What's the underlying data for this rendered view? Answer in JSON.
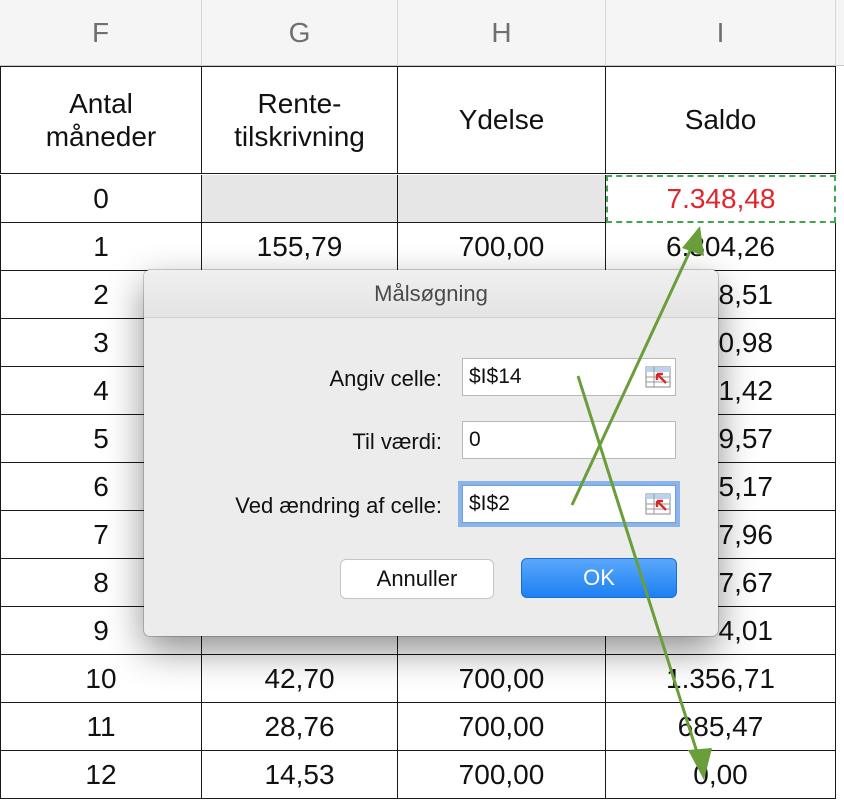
{
  "sheet": {
    "column_headers": [
      "F",
      "G",
      "H",
      "I"
    ],
    "table_headers": {
      "antal_line1": "Antal",
      "antal_line2": "måneder",
      "rente_line1": "Rente-",
      "rente_line2": "tilskrivning",
      "ydelse": "Ydelse",
      "saldo": "Saldo"
    },
    "rows": [
      {
        "months": "0",
        "interest": "",
        "payment": "",
        "balance": "7.348,48"
      },
      {
        "months": "1",
        "interest": "155,79",
        "payment": "700,00",
        "balance": "6.804,26"
      },
      {
        "months": "2",
        "interest": "",
        "payment": "",
        "balance": "8,51"
      },
      {
        "months": "3",
        "interest": "",
        "payment": "",
        "balance": "0,98"
      },
      {
        "months": "4",
        "interest": "",
        "payment": "",
        "balance": "1,42"
      },
      {
        "months": "5",
        "interest": "",
        "payment": "",
        "balance": "9,57"
      },
      {
        "months": "6",
        "interest": "",
        "payment": "",
        "balance": "5,17"
      },
      {
        "months": "7",
        "interest": "",
        "payment": "",
        "balance": "7,96"
      },
      {
        "months": "8",
        "interest": "",
        "payment": "",
        "balance": "7,67"
      },
      {
        "months": "9",
        "interest": "",
        "payment": "",
        "balance": "4,01"
      },
      {
        "months": "10",
        "interest": "42,70",
        "payment": "700,00",
        "balance": "1.356,71"
      },
      {
        "months": "11",
        "interest": "28,76",
        "payment": "700,00",
        "balance": "685,47"
      },
      {
        "months": "12",
        "interest": "14,53",
        "payment": "700,00",
        "balance": "0,00"
      }
    ],
    "highlight_color": "#e0262c",
    "selection_color": "#3fa64b"
  },
  "dialog": {
    "title": "Målsøgning",
    "set_cell_label": "Angiv celle:",
    "set_cell_value": "$I$14",
    "to_value_label": "Til værdi:",
    "to_value_value": "0",
    "changing_cell_label": "Ved ændring af celle:",
    "changing_cell_value": "$I$2",
    "cancel_label": "Annuller",
    "ok_label": "OK",
    "ok_color": "#1d80f3",
    "arrow_color": "#6a9e3a"
  }
}
